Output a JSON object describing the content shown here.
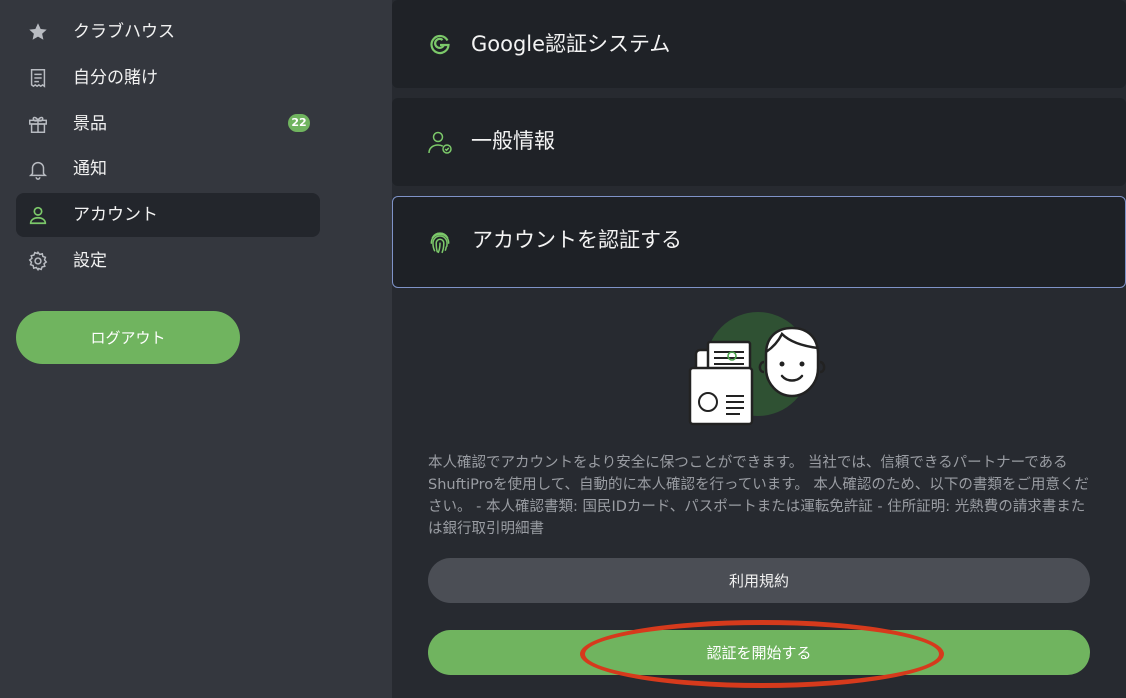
{
  "sidebar": {
    "items": [
      {
        "label": "クラブハウス",
        "icon": "star-icon"
      },
      {
        "label": "自分の賭け",
        "icon": "receipt-icon"
      },
      {
        "label": "景品",
        "icon": "gift-icon",
        "badge": "22"
      },
      {
        "label": "通知",
        "icon": "bell-icon"
      },
      {
        "label": "アカウント",
        "icon": "user-icon",
        "active": true
      },
      {
        "label": "設定",
        "icon": "gear-icon"
      }
    ],
    "logout_label": "ログアウト"
  },
  "main": {
    "panels": [
      {
        "title": "Google認証システム",
        "icon": "google-icon"
      },
      {
        "title": "一般情報",
        "icon": "user-check-icon"
      },
      {
        "title": "アカウントを認証する",
        "icon": "fingerprint-icon"
      }
    ],
    "verify": {
      "description": "本人確認でアカウントをより安全に保つことができます。 当社では、信頼できるパートナーであるShuftiProを使用して、自動的に本人確認を行っています。 本人確認のため、以下の書類をご用意ください。 - 本人確認書類: 国民IDカード、パスポートまたは運転免許証 - 住所証明: 光熱費の請求書または銀行取引明細書",
      "terms_label": "利用規約",
      "start_label": "認証を開始する"
    }
  },
  "colors": {
    "accent_green": "#70b45f",
    "sidebar_bg": "#34373e",
    "main_bg": "#272a30",
    "highlight_red": "#d63a1c"
  }
}
